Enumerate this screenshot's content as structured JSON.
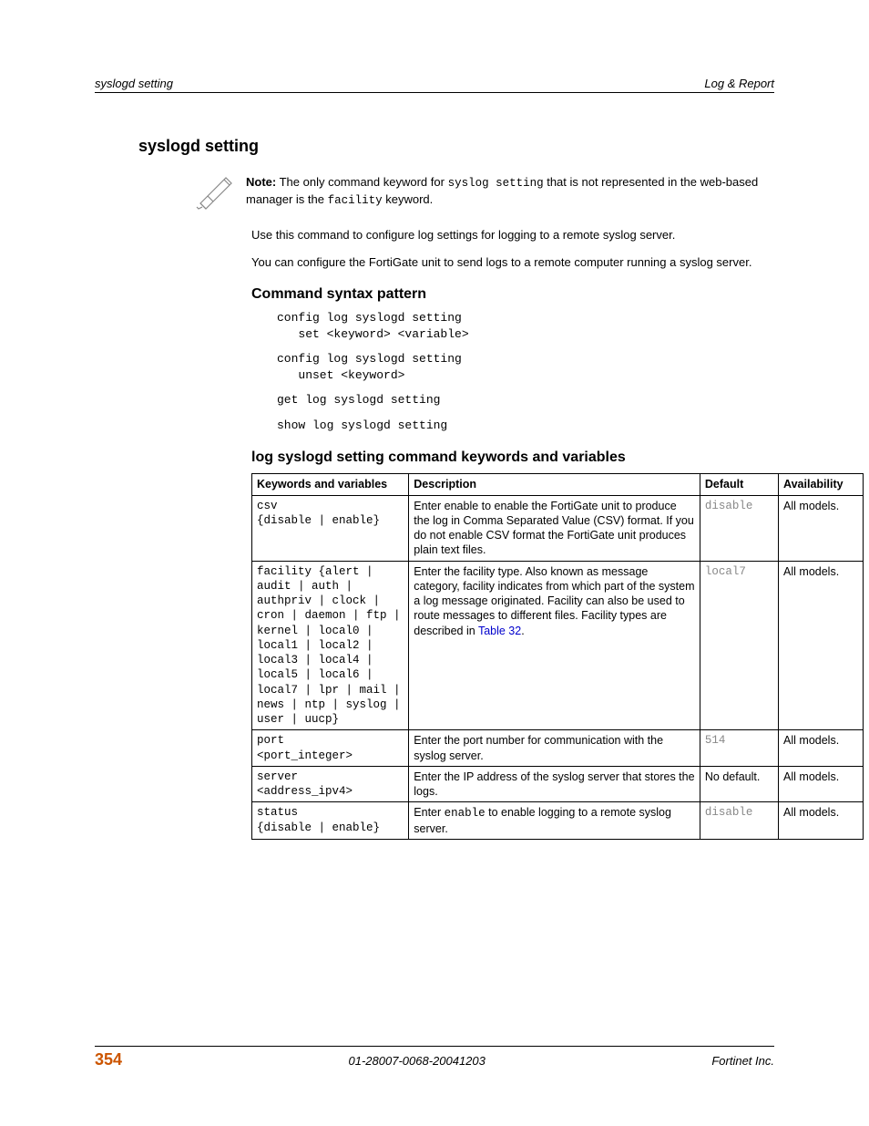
{
  "header": {
    "left": "syslogd setting",
    "right": "Log & Report"
  },
  "section_title": "syslogd setting",
  "note": {
    "prefix": "Note:",
    "text_a": " The only command keyword for ",
    "code_a": "syslog setting",
    "text_b": " that is not represented in the web-based manager is the ",
    "code_b": "facility",
    "text_c": " keyword."
  },
  "para1": "Use this command to configure log settings for logging to a remote syslog server.",
  "para2": "You can configure the FortiGate unit to send logs to a remote computer running a syslog server.",
  "subsection1": "Command syntax pattern",
  "code_block1": "config log syslogd setting\n   set <keyword> <variable>",
  "code_block2": "config log syslogd setting\n   unset <keyword>",
  "code_block3": "get log syslogd setting",
  "code_block4": "show log syslogd setting",
  "subsection2": "log syslogd setting command keywords and variables",
  "table": {
    "headers": {
      "kw": "Keywords and variables",
      "desc": "Description",
      "def": "Default",
      "avail": "Availability"
    },
    "rows": [
      {
        "kw": "csv\n{disable | enable}",
        "desc_plain": "Enter enable to enable the FortiGate unit to produce the log in Comma Separated Value (CSV) format. If you do not enable CSV format the FortiGate unit produces plain text files.",
        "def": "disable",
        "def_mono": true,
        "avail": "All models."
      },
      {
        "kw": "facility {alert | audit | auth | authpriv | clock | cron | daemon | ftp | kernel | local0 | local1 | local2 | local3 | local4 | local5 | local6 | local7 | lpr | mail | news | ntp | syslog | user | uucp}",
        "desc_pre": "Enter the facility type. Also known as message category, facility indicates from which part of the system a log message originated. Facility can also be used to route messages to different files. Facility types are described in ",
        "desc_link": "Table 32",
        "desc_post": ".",
        "def": "local7",
        "def_mono": true,
        "avail": "All models."
      },
      {
        "kw": "port\n<port_integer>",
        "desc_plain": "Enter the port number for communication with the syslog server.",
        "def": "514",
        "def_mono": true,
        "avail": "All models."
      },
      {
        "kw": "server\n<address_ipv4>",
        "desc_plain": "Enter the IP address of the syslog server that stores the logs.",
        "def": "No default.",
        "def_mono": false,
        "avail": "All models."
      },
      {
        "kw": "status\n{disable | enable}",
        "desc_pre": "Enter ",
        "desc_code": "enable",
        "desc_post_plain": " to enable logging to a remote syslog server.",
        "def": "disable",
        "def_mono": true,
        "avail": "All models."
      }
    ]
  },
  "footer": {
    "page": "354",
    "center": "01-28007-0068-20041203",
    "right": "Fortinet Inc."
  }
}
